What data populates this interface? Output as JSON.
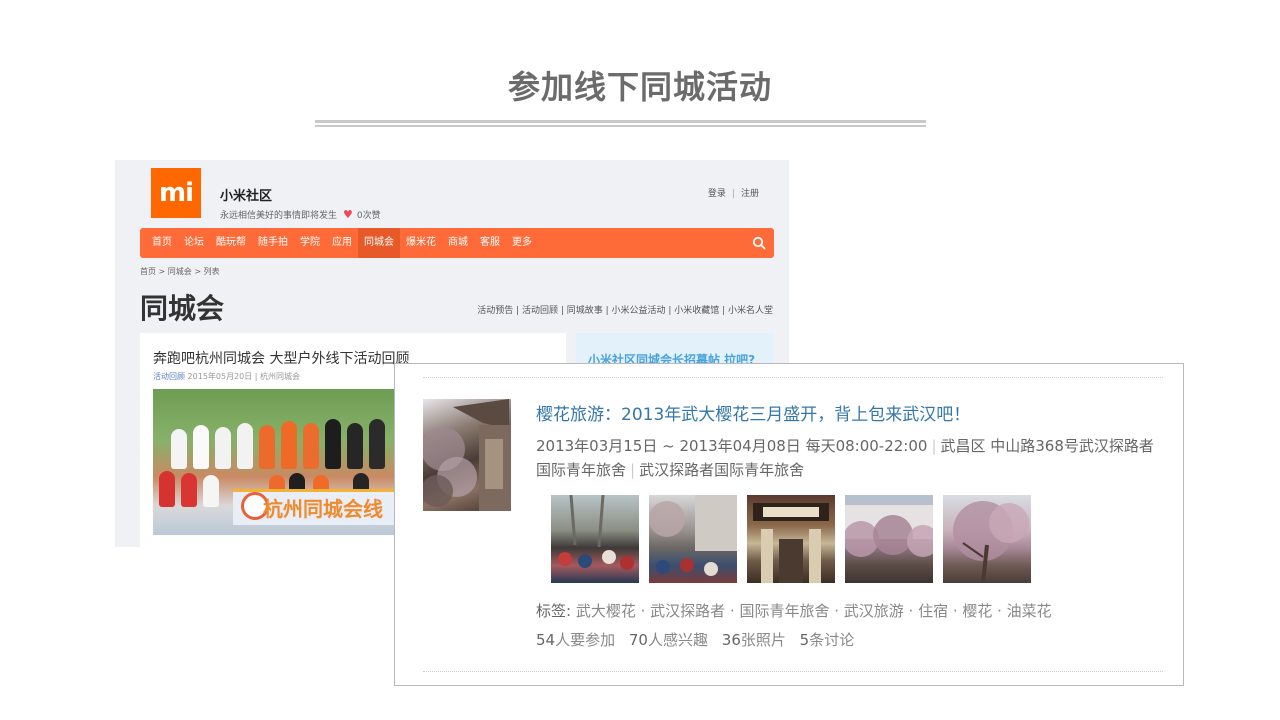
{
  "slide": {
    "title": "参加线下同城活动"
  },
  "community": {
    "logo_text": "mi",
    "site_name": "小米社区",
    "slogan": "永远相信美好的事情即将发生",
    "likes": "0次赞",
    "login": "登录",
    "register": "注册",
    "nav": [
      "首页",
      "论坛",
      "酷玩帮",
      "随手拍",
      "学院",
      "应用",
      "同城会",
      "爆米花",
      "商城",
      "客服",
      "更多"
    ],
    "nav_active": "同城会",
    "breadcrumb": "首页 > 同城会 > 列表",
    "page_title": "同城会",
    "subnav": "活动预告 | 活动回顾 | 同城故事 | 小米公益活动 | 小米收藏馆 | 小米名人堂",
    "card": {
      "title": "奔跑吧杭州同城会 大型户外线下活动回顾",
      "meta_tag": "活动回顾",
      "meta_rest": " 2015年05月20日 | 杭州同城会",
      "banner_text": "杭州同城会线"
    },
    "side_text": "小米社区同城会长招募帖 拉吧?"
  },
  "event": {
    "title": "樱花旅游：2013年武大樱花三月盛开，背上包来武汉吧！",
    "time": "2013年03月15日 ~ 2013年04月08日 每天08:00-22:00",
    "location": "武昌区 中山路368号武汉探路者国际青年旅舍",
    "organizer": "武汉探路者国际青年旅舍",
    "tags_label": "标签:",
    "tags": "武大樱花 · 武汉探路者 · 国际青年旅舍 · 武汉旅游 · 住宿 · 樱花 · 油菜花",
    "stats": [
      {
        "num": "54",
        "text": "人要参加"
      },
      {
        "num": "70",
        "text": "人感兴趣"
      },
      {
        "num": "36",
        "text": "张照片"
      },
      {
        "num": "5",
        "text": "条讨论"
      }
    ]
  }
}
